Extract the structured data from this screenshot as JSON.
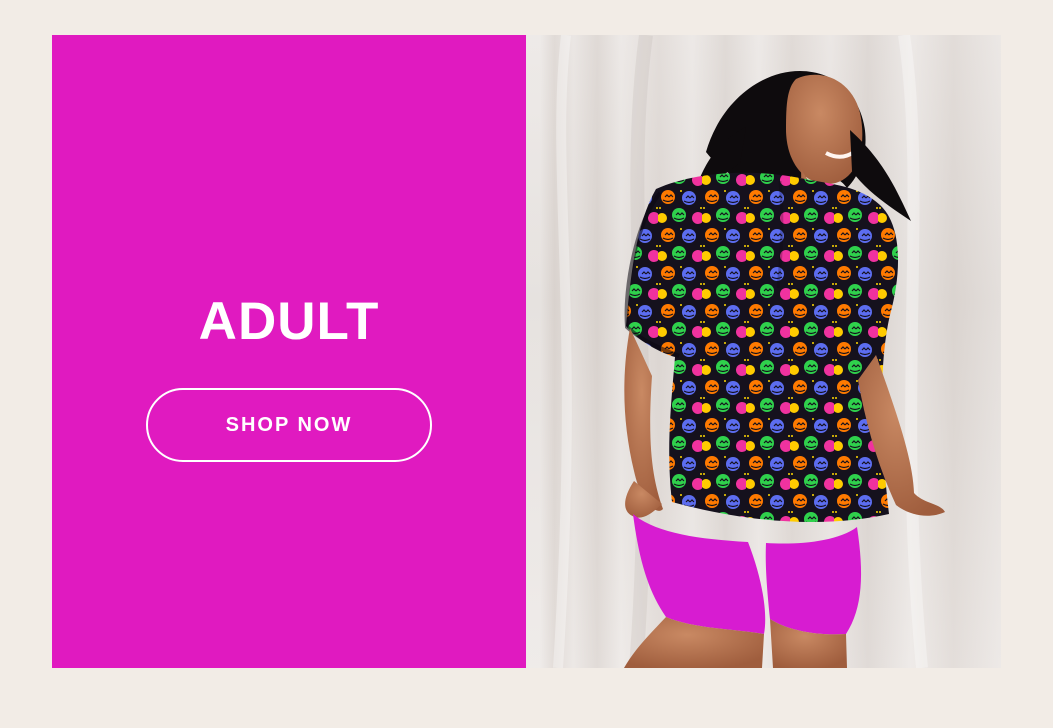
{
  "promo": {
    "title": "ADULT",
    "cta_label": "SHOP NOW"
  },
  "colors": {
    "page_background": "#f2ece6",
    "promo_panel": "#e01ac0",
    "text": "#ffffff",
    "shorts": "#d71cd1",
    "shirt_base": "#15111d"
  },
  "photo": {
    "subject": "model-in-pumpkin-print-tee"
  }
}
